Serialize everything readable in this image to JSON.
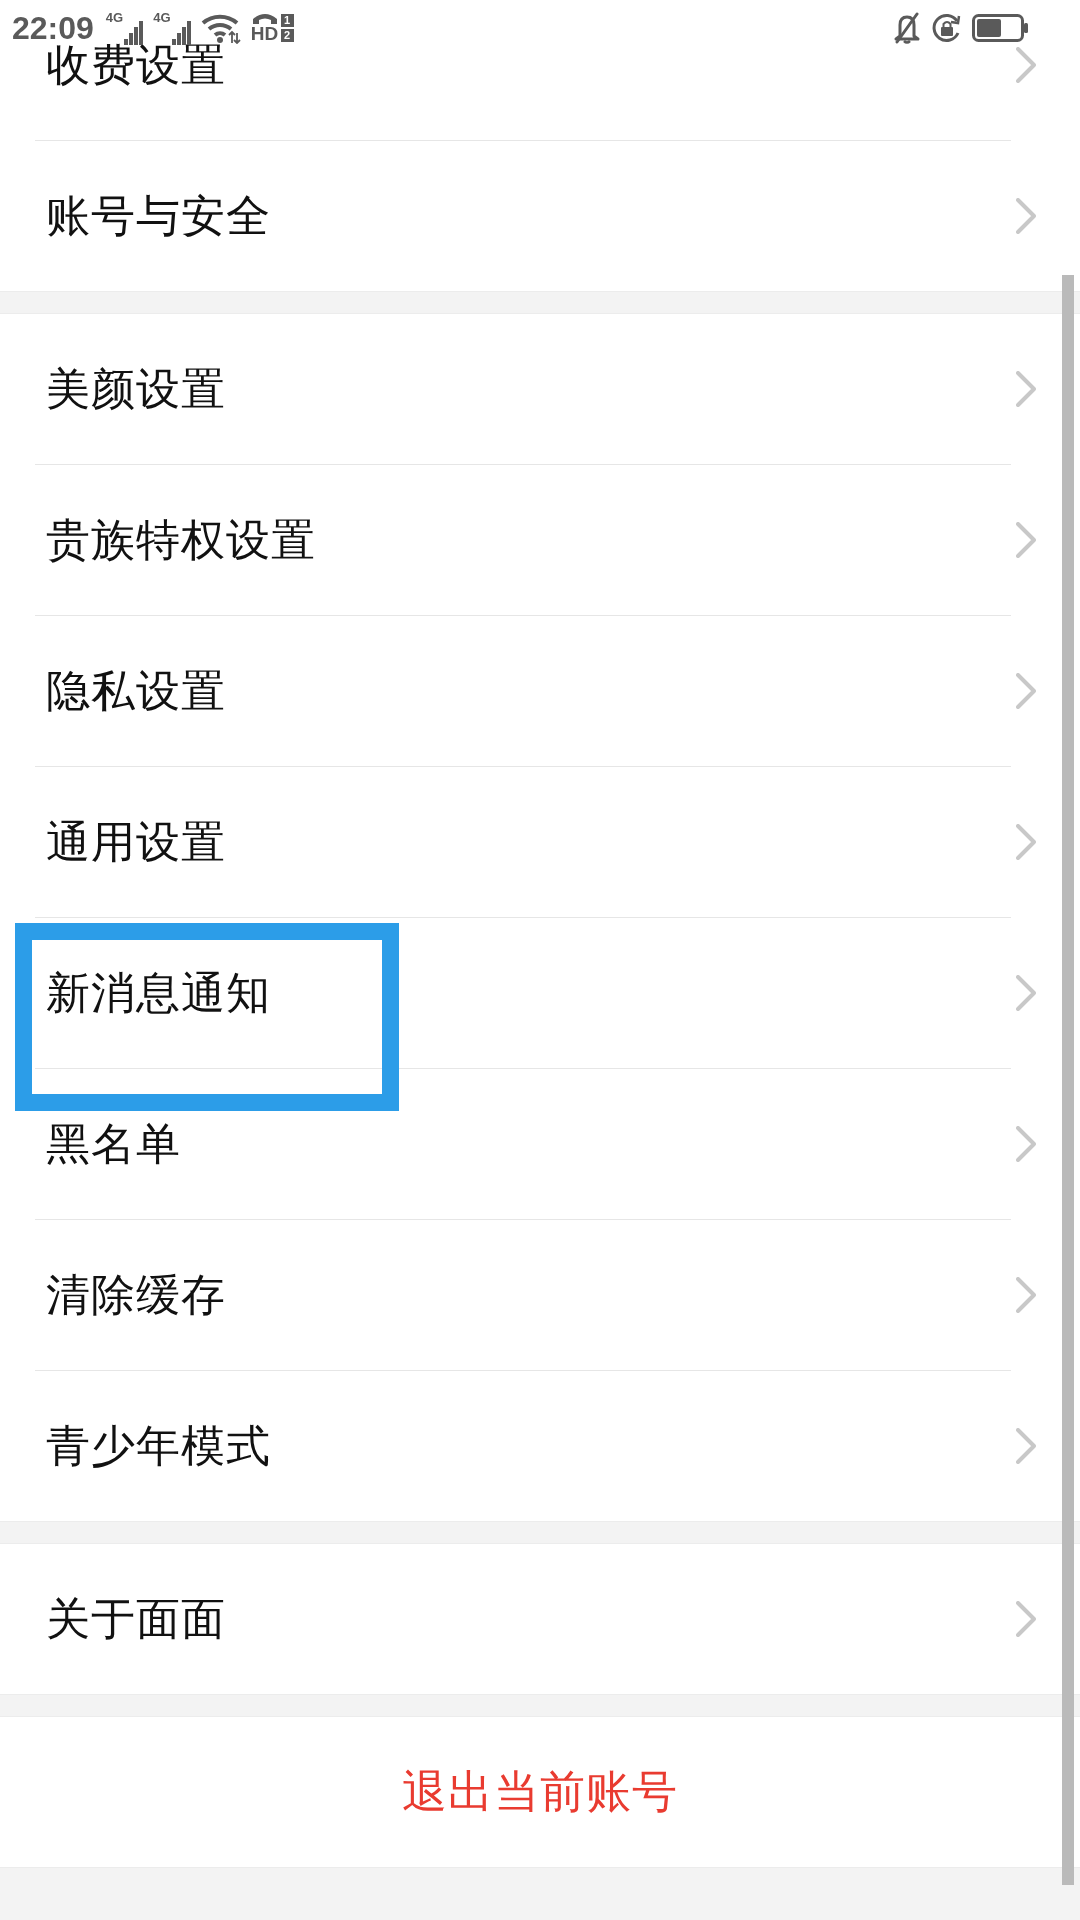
{
  "status_bar": {
    "time": "22:09",
    "signals": [
      {
        "network": "4G"
      },
      {
        "network": "4G"
      }
    ],
    "hd_call": {
      "label": "HD",
      "sim_slots": [
        "1",
        "2"
      ]
    }
  },
  "groups": [
    {
      "items": [
        {
          "label": "收费设置",
          "highlighted": false
        },
        {
          "label": "账号与安全",
          "highlighted": false
        }
      ]
    },
    {
      "items": [
        {
          "label": "美颜设置",
          "highlighted": false
        },
        {
          "label": "贵族特权设置",
          "highlighted": false
        },
        {
          "label": "隐私设置",
          "highlighted": false
        },
        {
          "label": "通用设置",
          "highlighted": false
        },
        {
          "label": "新消息通知",
          "highlighted": true
        },
        {
          "label": "黑名单",
          "highlighted": false
        },
        {
          "label": "清除缓存",
          "highlighted": false
        },
        {
          "label": "青少年模式",
          "highlighted": false
        }
      ]
    },
    {
      "items": [
        {
          "label": "关于面面",
          "highlighted": false
        }
      ]
    }
  ],
  "logout_button": {
    "label": "退出当前账号"
  }
}
